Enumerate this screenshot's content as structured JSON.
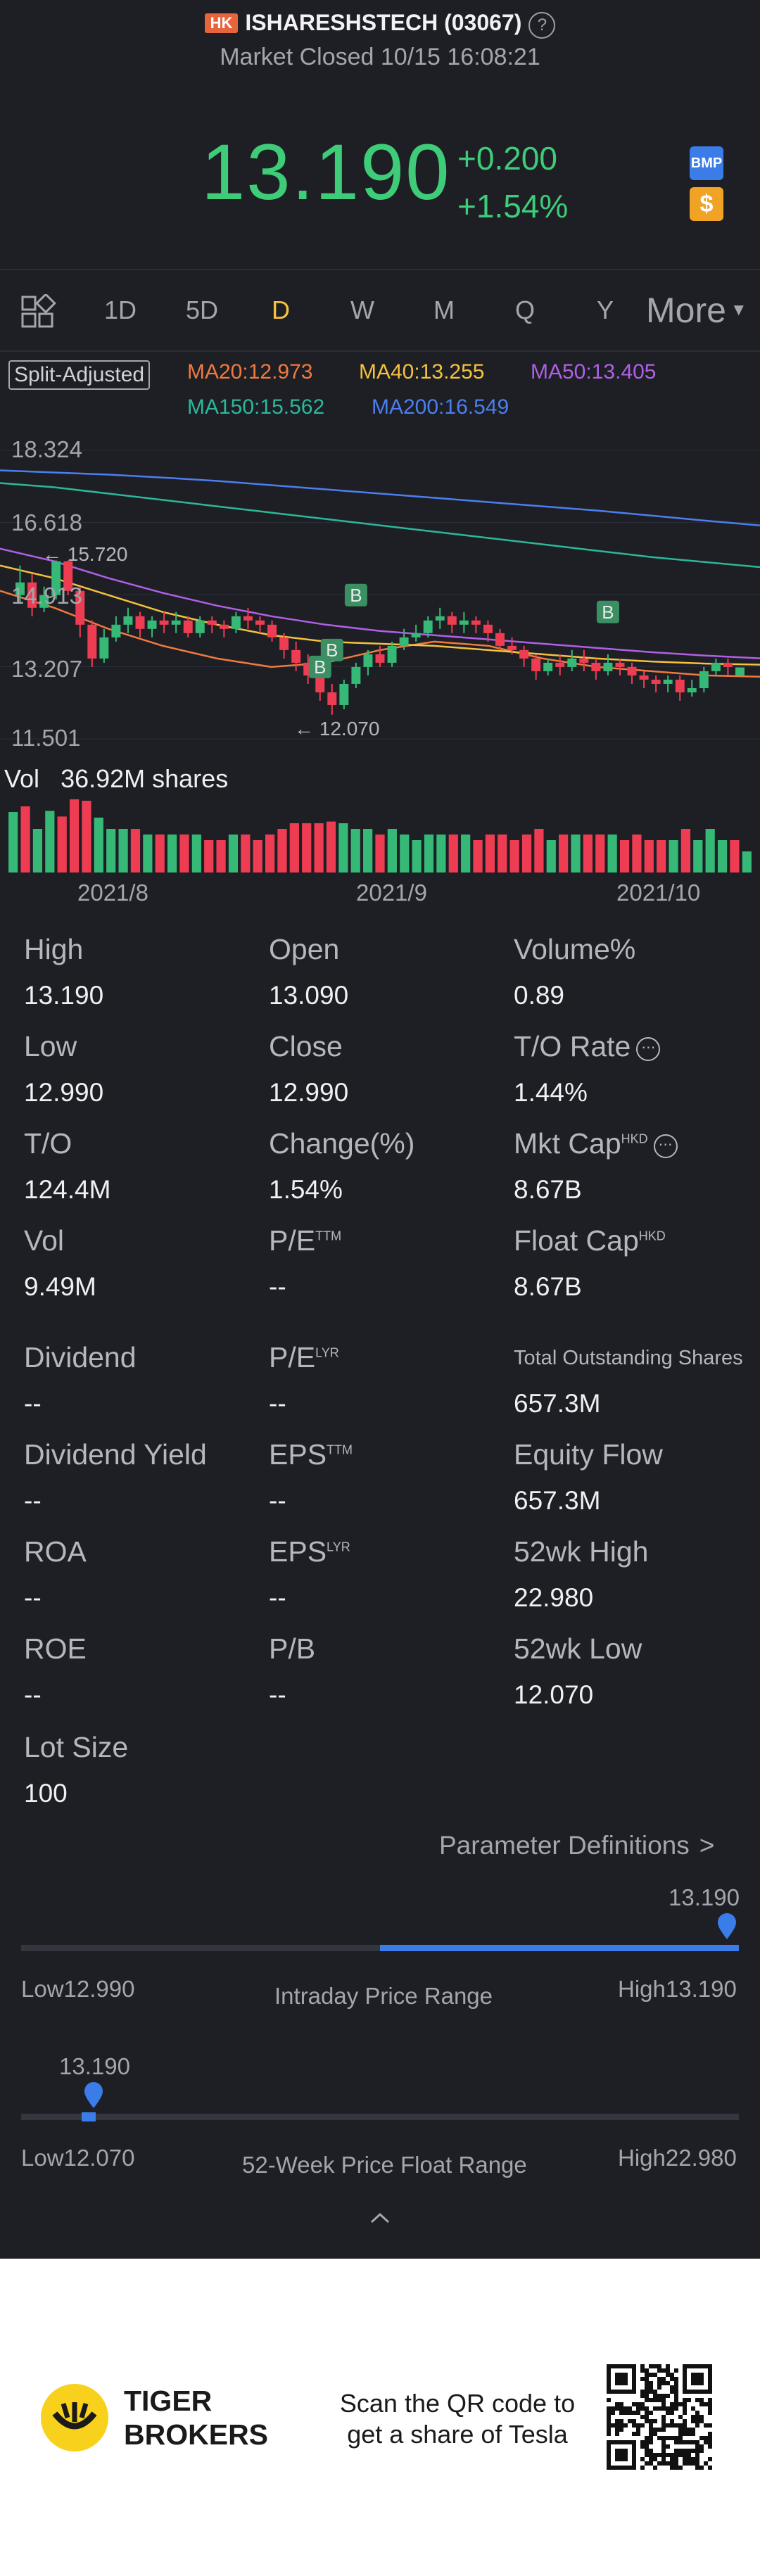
{
  "header": {
    "market_badge": "HK",
    "title": "ISHARESHSTECH (03067)",
    "status": "Market Closed 10/15 16:08:21"
  },
  "quote": {
    "price": "13.190",
    "change": "+0.200",
    "change_pct": "+1.54%",
    "bmp_label": "BMP",
    "dollar_label": "$"
  },
  "tabs": [
    "1D",
    "5D",
    "D",
    "W",
    "M",
    "Q",
    "Y"
  ],
  "active_tab": "D",
  "more_label": "More",
  "ma": {
    "adjust": "Split-Adjusted",
    "ma20": "MA20:12.973",
    "ma40": "MA40:13.255",
    "ma50": "MA50:13.405",
    "ma150": "MA150:15.562",
    "ma200": "MA200:16.549"
  },
  "chart_data": {
    "type": "candlestick",
    "y_ticks": [
      "18.324",
      "16.618",
      "14.913",
      "13.207",
      "11.501"
    ],
    "ylim": [
      11.501,
      18.324
    ],
    "x_ticks": [
      "2021/8",
      "2021/9",
      "2021/10"
    ],
    "annotations": {
      "high_label": "15.720",
      "low_label": "12.070",
      "marker": "B"
    },
    "candles": [
      [
        14.9,
        15.2,
        15.6,
        14.7
      ],
      [
        15.2,
        14.6,
        15.4,
        14.4
      ],
      [
        14.6,
        14.9,
        15.1,
        14.5
      ],
      [
        14.9,
        15.7,
        15.72,
        14.8
      ],
      [
        15.7,
        15.0,
        15.72,
        14.9
      ],
      [
        15.0,
        14.2,
        15.1,
        13.9
      ],
      [
        14.2,
        13.4,
        14.3,
        13.2
      ],
      [
        13.4,
        13.9,
        14.1,
        13.3
      ],
      [
        13.9,
        14.2,
        14.4,
        13.8
      ],
      [
        14.2,
        14.4,
        14.6,
        14.0
      ],
      [
        14.4,
        14.1,
        14.5,
        13.9
      ],
      [
        14.1,
        14.3,
        14.4,
        13.9
      ],
      [
        14.3,
        14.2,
        14.5,
        14.0
      ],
      [
        14.2,
        14.3,
        14.5,
        14.0
      ],
      [
        14.3,
        14.0,
        14.4,
        13.9
      ],
      [
        14.0,
        14.3,
        14.4,
        13.9
      ],
      [
        14.3,
        14.2,
        14.4,
        14.0
      ],
      [
        14.2,
        14.1,
        14.3,
        13.9
      ],
      [
        14.1,
        14.4,
        14.5,
        14.0
      ],
      [
        14.4,
        14.3,
        14.6,
        14.1
      ],
      [
        14.3,
        14.2,
        14.4,
        14.0
      ],
      [
        14.2,
        13.9,
        14.3,
        13.8
      ],
      [
        13.9,
        13.6,
        14.0,
        13.4
      ],
      [
        13.6,
        13.3,
        13.8,
        13.1
      ],
      [
        13.3,
        13.0,
        13.5,
        12.8
      ],
      [
        13.0,
        12.6,
        13.1,
        12.4
      ],
      [
        12.6,
        12.3,
        12.8,
        12.07
      ],
      [
        12.3,
        12.8,
        12.9,
        12.2
      ],
      [
        12.8,
        13.2,
        13.3,
        12.7
      ],
      [
        13.2,
        13.5,
        13.6,
        13.0
      ],
      [
        13.5,
        13.3,
        13.7,
        13.2
      ],
      [
        13.3,
        13.7,
        13.8,
        13.2
      ],
      [
        13.7,
        13.9,
        14.1,
        13.6
      ],
      [
        13.9,
        14.0,
        14.2,
        13.8
      ],
      [
        14.0,
        14.3,
        14.4,
        13.9
      ],
      [
        14.3,
        14.4,
        14.6,
        14.1
      ],
      [
        14.4,
        14.2,
        14.5,
        14.0
      ],
      [
        14.2,
        14.3,
        14.5,
        14.0
      ],
      [
        14.3,
        14.2,
        14.4,
        14.0
      ],
      [
        14.2,
        14.0,
        14.3,
        13.8
      ],
      [
        14.0,
        13.7,
        14.1,
        13.6
      ],
      [
        13.7,
        13.6,
        13.9,
        13.5
      ],
      [
        13.6,
        13.4,
        13.7,
        13.2
      ],
      [
        13.4,
        13.1,
        13.5,
        12.9
      ],
      [
        13.1,
        13.3,
        13.4,
        13.0
      ],
      [
        13.3,
        13.2,
        13.5,
        13.0
      ],
      [
        13.2,
        13.4,
        13.6,
        13.1
      ],
      [
        13.4,
        13.3,
        13.6,
        13.1
      ],
      [
        13.3,
        13.1,
        13.4,
        12.9
      ],
      [
        13.1,
        13.3,
        13.5,
        13.0
      ],
      [
        13.3,
        13.2,
        13.4,
        13.0
      ],
      [
        13.2,
        13.0,
        13.3,
        12.8
      ],
      [
        13.0,
        12.9,
        13.1,
        12.7
      ],
      [
        12.9,
        12.8,
        13.0,
        12.6
      ],
      [
        12.8,
        12.9,
        13.0,
        12.6
      ],
      [
        12.9,
        12.6,
        13.0,
        12.4
      ],
      [
        12.6,
        12.7,
        12.9,
        12.5
      ],
      [
        12.7,
        13.1,
        13.2,
        12.6
      ],
      [
        13.1,
        13.3,
        13.4,
        13.0
      ],
      [
        13.3,
        13.2,
        13.4,
        13.0
      ],
      [
        12.99,
        13.19,
        13.19,
        12.99
      ]
    ],
    "ma_series": [
      {
        "name": "MA20",
        "color": "#f07a3e",
        "values": [
          15.0,
          14.6,
          14.1,
          13.7,
          13.4,
          13.2,
          13.3,
          13.6,
          13.8,
          13.7,
          13.4,
          13.2,
          13.1,
          13.0,
          12.97
        ]
      },
      {
        "name": "MA40",
        "color": "#f4c23c",
        "values": [
          15.6,
          15.3,
          14.9,
          14.5,
          14.2,
          13.95,
          13.8,
          13.75,
          13.7,
          13.6,
          13.5,
          13.4,
          13.33,
          13.28,
          13.255
        ]
      },
      {
        "name": "MA50",
        "color": "#b160e6",
        "values": [
          16.0,
          15.7,
          15.3,
          14.95,
          14.65,
          14.4,
          14.2,
          14.05,
          13.95,
          13.85,
          13.75,
          13.65,
          13.55,
          13.47,
          13.405
        ]
      },
      {
        "name": "MA150",
        "color": "#2bb89a",
        "values": [
          17.55,
          17.45,
          17.3,
          17.15,
          17.0,
          16.85,
          16.7,
          16.55,
          16.4,
          16.25,
          16.1,
          15.95,
          15.8,
          15.68,
          15.562
        ]
      },
      {
        "name": "MA200",
        "color": "#4b7ff0",
        "values": [
          17.85,
          17.8,
          17.75,
          17.68,
          17.6,
          17.5,
          17.4,
          17.3,
          17.2,
          17.1,
          17.0,
          16.9,
          16.78,
          16.66,
          16.549
        ]
      }
    ]
  },
  "volume": {
    "label": "Vol",
    "value": "36.92M shares"
  },
  "stats": [
    {
      "label": "High",
      "value": "13.190"
    },
    {
      "label": "Open",
      "value": "13.090"
    },
    {
      "label": "Volume%",
      "value": "0.89"
    },
    {
      "label": "Low",
      "value": "12.990"
    },
    {
      "label": "Close",
      "value": "12.990"
    },
    {
      "label": "T/O Rate",
      "value": "1.44%"
    },
    {
      "label": "T/O",
      "value": "124.4M"
    },
    {
      "label": "Change(%)",
      "value": "1.54%"
    },
    {
      "label": "Mkt Cap",
      "sup": "HKD",
      "value": "8.67B"
    },
    {
      "label": "Vol",
      "value": "9.49M"
    },
    {
      "label": "P/E",
      "sup": "TTM",
      "value": "--"
    },
    {
      "label": "Float Cap",
      "sup": "HKD",
      "value": "8.67B"
    },
    {
      "label": "Dividend",
      "value": "--"
    },
    {
      "label": "P/E",
      "sup": "LYR",
      "value": "--"
    },
    {
      "label": "Total Outstanding Shares",
      "value": "657.3M"
    },
    {
      "label": "Dividend Yield",
      "value": "--"
    },
    {
      "label": "EPS",
      "sup": "TTM",
      "value": "--"
    },
    {
      "label": "Equity Flow",
      "value": "657.3M"
    },
    {
      "label": "ROA",
      "value": "--"
    },
    {
      "label": "EPS",
      "sup": "LYR",
      "value": "--"
    },
    {
      "label": "52wk High",
      "value": "22.980"
    },
    {
      "label": "ROE",
      "value": "--"
    },
    {
      "label": "P/B",
      "value": "--"
    },
    {
      "label": "52wk Low",
      "value": "12.070"
    },
    {
      "label": "Lot Size",
      "value": "100"
    }
  ],
  "param_link": "Parameter Definitions",
  "intraday": {
    "current": "13.190",
    "low_label": "Low",
    "low": "12.990",
    "high_label": "High",
    "high": "13.190",
    "title": "Intraday Price Range",
    "fill_from": 0.5,
    "position": 1.0
  },
  "week52": {
    "current": "13.190",
    "low_label": "Low",
    "low": "12.070",
    "high_label": "High",
    "high": "22.980",
    "title": "52-Week Price Float Range",
    "position": 0.1
  },
  "footer": {
    "brand_line1": "TIGER",
    "brand_line2": "BROKERS",
    "promo_line1": "Scan the QR code to",
    "promo_line2": "get a share of Tesla"
  }
}
